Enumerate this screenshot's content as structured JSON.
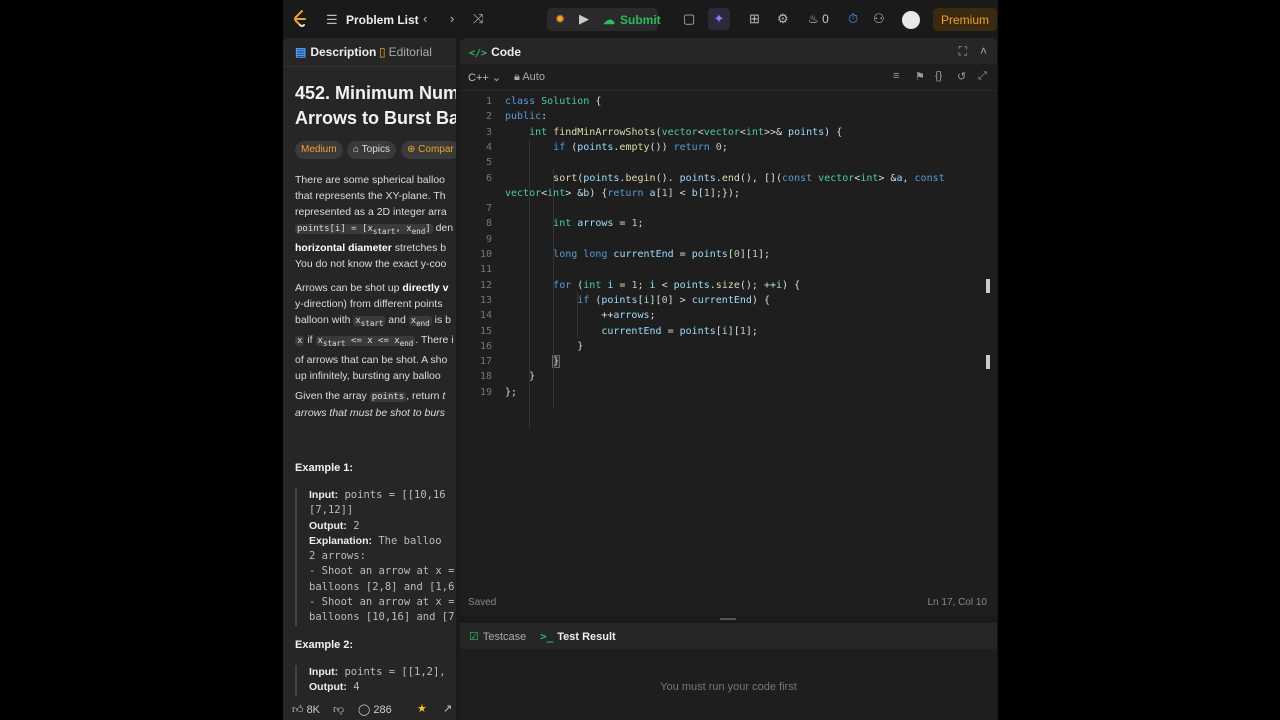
{
  "topbar": {
    "problem_list_label": "Problem List",
    "submit_label": "Submit",
    "streak_count": "0",
    "premium_label": "Premium"
  },
  "left_panel": {
    "tab_description": "Description",
    "tab_editorial": "Editorial",
    "title_line1": "452. Minimum Num",
    "title_line2": "Arrows to Burst Bal",
    "tag_difficulty": "Medium",
    "tag_topics": "Topics",
    "tag_companies": "Compar",
    "para1": [
      "There are some spherical balloo",
      "that represents the XY-plane. Th",
      "represented as a 2D integer arra",
      "points[i] = [xstart, xend] den",
      "horizontal diameter stretches b",
      "You do not know the exact y-coo"
    ],
    "para2": [
      "Arrows can be shot up directly v",
      "y-direction) from different points",
      "balloon with xstart and xend is b",
      "x if xstart <= x <= xend. There i",
      "of arrows that can be shot. A sho",
      "up infinitely, bursting any balloo"
    ],
    "para3": [
      "Given the array points, return t",
      "arrows that must be shot to burs"
    ],
    "example1": {
      "heading": "Example 1:",
      "lines": [
        "Input: points = [[10,16",
        "[7,12]]",
        "Output: 2",
        "Explanation: The balloo",
        "2 arrows:",
        "- Shoot an arrow at x =",
        "balloons [2,8] and [1,6",
        "- Shoot an arrow at x =",
        "balloons [10,16] and [7"
      ]
    },
    "example2": {
      "heading": "Example 2:",
      "lines": [
        "Input: points = [[1,2],",
        "Output: 4"
      ]
    },
    "likes": "8K",
    "comments": "286"
  },
  "editor": {
    "title": "Code",
    "language": "C++",
    "mode": "Auto",
    "saved_label": "Saved",
    "cursor_position": "Ln 17, Col 10",
    "lines": [
      "class Solution {",
      "public:",
      "    int findMinArrowShots(vector<vector<int>>& points) {",
      "        if (points.empty()) return 0;",
      "",
      "        sort(points.begin(). points.end(), [](const vector<int> &a, const",
      "vector<int> &b) {return a[1] < b[1];});",
      "",
      "        int arrows = 1;",
      "",
      "        long long currentEnd = points[0][1];",
      "",
      "        for (int i = 1; i < points.size(); ++i) {",
      "            if (points[i][0] > currentEnd) {",
      "                ++arrows;",
      "                currentEnd = points[i][1];",
      "            }",
      "        }",
      "    }",
      "};"
    ],
    "line_numbers": [
      "1",
      "2",
      "3",
      "4",
      "5",
      "6",
      "",
      "7",
      "8",
      "9",
      "10",
      "11",
      "12",
      "13",
      "14",
      "15",
      "16",
      "17",
      "18",
      "19"
    ]
  },
  "bottom_panel": {
    "tab_testcase": "Testcase",
    "tab_result": "Test Result",
    "message": "You must run your code first"
  }
}
